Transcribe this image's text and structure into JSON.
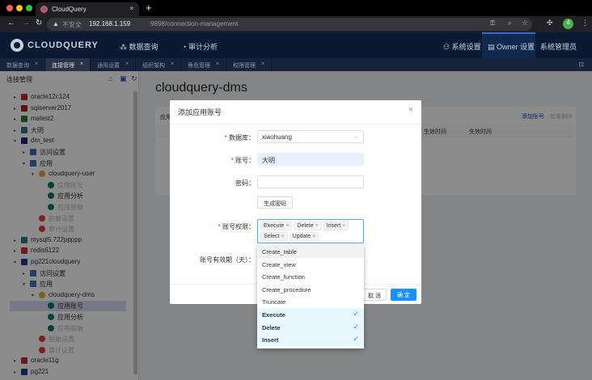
{
  "browser": {
    "tab_title": "CloudQuery",
    "new_tab": "+",
    "close": "×",
    "security": "不安全",
    "url_host": "192.168.1.159",
    "url_rest": ":9898/connection-management",
    "profile": "d"
  },
  "header": {
    "brand": "CLOUDQUERY",
    "nav": [
      "数据查询",
      "审计分析"
    ],
    "right": [
      "系统设置",
      "Owner 设置",
      "系统管理员"
    ]
  },
  "app_tabs": [
    "数据查询",
    "连接管理",
    "通用设置",
    "组织架构",
    "角色管理",
    "权限管理"
  ],
  "active_tab": 1,
  "sidebar": {
    "title": "连接管理",
    "tree": [
      {
        "label": "oracle12c124",
        "level": 0,
        "arrow": "▸",
        "color": "#c62828"
      },
      {
        "label": "sqlserver2017",
        "level": 0,
        "arrow": "▸",
        "color": "#b71c1c"
      },
      {
        "label": "matest2",
        "level": 0,
        "arrow": "▸",
        "color": "#2e7d32"
      },
      {
        "label": "大明",
        "level": 0,
        "arrow": "▸",
        "color": "#37718e"
      },
      {
        "label": "dm_test",
        "level": 0,
        "arrow": "▾",
        "color": "#1a237e"
      },
      {
        "label": "访问设置",
        "level": 1,
        "arrow": "▸",
        "color": "#3f6fb5"
      },
      {
        "label": "应用",
        "level": 1,
        "arrow": "▾",
        "color": "#3f6fb5"
      },
      {
        "label": "cloudquery-user",
        "level": 2,
        "arrow": "▾",
        "color": "#e8a33a"
      },
      {
        "label": "应用账号",
        "level": 3,
        "color": "#00796b",
        "dim": true
      },
      {
        "label": "应用分析",
        "level": 3,
        "color": "#00796b"
      },
      {
        "label": "应用脱敏",
        "level": 3,
        "color": "#00796b",
        "dim": true
      },
      {
        "label": "脱敏设置",
        "level": 2,
        "color": "#e53935",
        "dim": true
      },
      {
        "label": "审计设置",
        "level": 2,
        "color": "#e53935",
        "dim": true
      },
      {
        "label": "mysql5.722ppppp",
        "level": 0,
        "arrow": "▸",
        "color": "#37718e"
      },
      {
        "label": "redis6122",
        "level": 0,
        "arrow": "▸",
        "color": "#d32f2f"
      },
      {
        "label": "pg221cloudquery",
        "level": 0,
        "arrow": "▾",
        "color": "#1a3f8e"
      },
      {
        "label": "访问设置",
        "level": 1,
        "arrow": "▸",
        "color": "#3f6fb5"
      },
      {
        "label": "应用",
        "level": 1,
        "arrow": "▾",
        "color": "#3f6fb5"
      },
      {
        "label": "cloudquery-dms",
        "level": 2,
        "arrow": "▾",
        "color": "#e8a33a"
      },
      {
        "label": "应用账号",
        "level": 3,
        "color": "#00796b",
        "selected": true
      },
      {
        "label": "应用分析",
        "level": 3,
        "color": "#00796b"
      },
      {
        "label": "应用脱敏",
        "level": 3,
        "color": "#00796b",
        "dim": true
      },
      {
        "label": "脱敏设置",
        "level": 2,
        "color": "#e53935",
        "dim": true
      },
      {
        "label": "审计设置",
        "level": 2,
        "color": "#e53935",
        "dim": true
      },
      {
        "label": "oracle11g",
        "level": 0,
        "arrow": "▸",
        "color": "#c62828"
      },
      {
        "label": "pg221",
        "level": 0,
        "arrow": "▸",
        "color": "#1a3f8e"
      }
    ]
  },
  "main": {
    "title": "cloudquery-dms",
    "card_label": "应用",
    "add_link": "添加账号",
    "batch_delete": "批量删除",
    "columns": [
      "生效时间",
      "失效时间"
    ]
  },
  "modal": {
    "title": "添加应用账号",
    "close": "×",
    "db_label": "数据库：",
    "db_value": "xiaohuang",
    "account_label": "账号：",
    "account_value": "大明",
    "password_label": "密码：",
    "password_value": "",
    "gen_password": "生成密码",
    "perm_label": "账号权限：",
    "perm_tags": [
      "Execute",
      "Delete",
      "Insert",
      "Select",
      "Update"
    ],
    "expiry_label": "账号有效期（天）：",
    "cancel": "取 消",
    "ok": "确 定"
  },
  "dropdown": {
    "options": [
      {
        "label": "Create_table",
        "selected": false
      },
      {
        "label": "Create_view",
        "selected": false
      },
      {
        "label": "Create_function",
        "selected": false
      },
      {
        "label": "Create_procedure",
        "selected": false
      },
      {
        "label": "Truncate",
        "selected": false
      },
      {
        "label": "Execute",
        "selected": true
      },
      {
        "label": "Delete",
        "selected": true
      },
      {
        "label": "Insert",
        "selected": true
      }
    ]
  },
  "colors": {
    "primary": "#1890ff",
    "header": "#0b1a33",
    "required": "#f5222d"
  }
}
